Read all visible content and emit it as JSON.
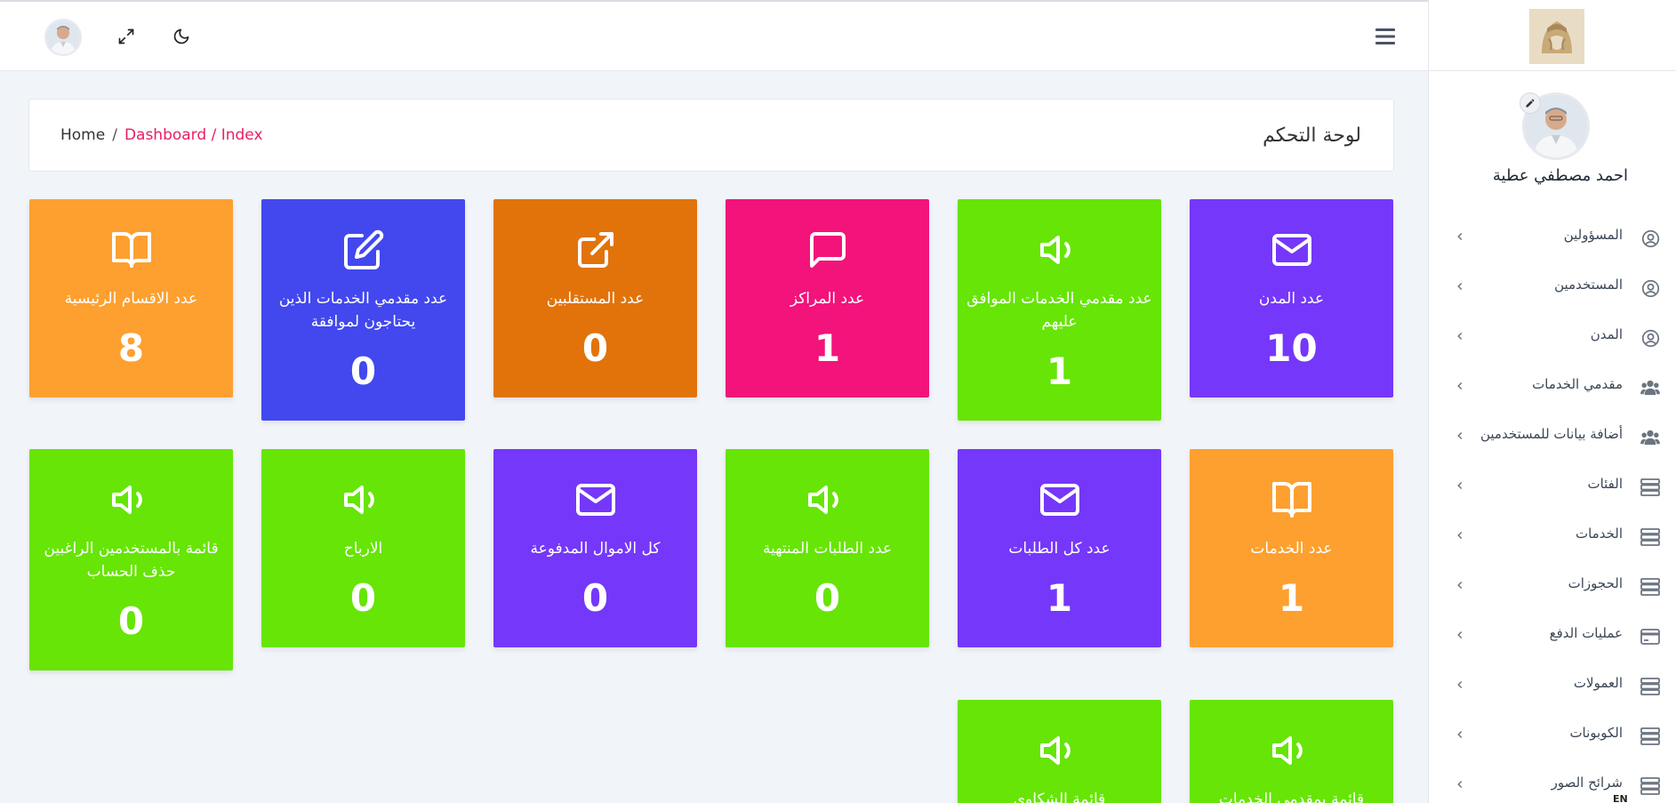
{
  "topbar": {
    "avatar_icon": "user-avatar",
    "expand_icon": "expand-icon",
    "theme_icon": "moon-icon",
    "menu_icon": "hamburger-menu-icon"
  },
  "sidebar": {
    "logo_icon": "brand-logo",
    "user_name": "احمد مصطفي عطية",
    "items": [
      {
        "label": "المسؤولين",
        "icon": "user-circle-icon"
      },
      {
        "label": "المستخدمين",
        "icon": "user-circle-icon"
      },
      {
        "label": "المدن",
        "icon": "user-circle-icon"
      },
      {
        "label": "مقدمي الخدمات",
        "icon": "users-icon"
      },
      {
        "label": "أضافة بيانات للمستخدمين",
        "icon": "users-icon"
      },
      {
        "label": "الفئات",
        "icon": "server-icon"
      },
      {
        "label": "الخدمات",
        "icon": "server-icon"
      },
      {
        "label": "الحجوزات",
        "icon": "server-icon"
      },
      {
        "label": "عمليات الدفع",
        "icon": "credit-card-icon"
      },
      {
        "label": "العمولات",
        "icon": "server-icon"
      },
      {
        "label": "الكوبونات",
        "icon": "server-icon"
      },
      {
        "label": "شرائح الصور",
        "icon": "server-icon"
      }
    ],
    "lang": "EN"
  },
  "breadcrumb": {
    "home": "Home",
    "separator": "/",
    "active": "Dashboard / Index",
    "title": "لوحة التحكم"
  },
  "tiles": [
    {
      "label": "عدد المدن",
      "value": "10",
      "icon": "envelope-icon",
      "color": "#7537fa"
    },
    {
      "label": "عدد مقدمي الخدمات الموافق عليهم",
      "value": "1",
      "icon": "megaphone-icon",
      "color": "#66e506"
    },
    {
      "label": "عدد المراكز",
      "value": "1",
      "icon": "message-square-icon",
      "color": "#f2137b"
    },
    {
      "label": "عدد المستقلبين",
      "value": "0",
      "icon": "external-link-icon",
      "color": "#e2730b"
    },
    {
      "label": "عدد مقدمي الخدمات الذين يحتاجون لموافقة",
      "value": "0",
      "icon": "edit-icon",
      "color": "#4248ee"
    },
    {
      "label": "عدد الاقسام الرئيسية",
      "value": "8",
      "icon": "book-open-icon",
      "color": "#fda02f"
    },
    {
      "label": "عدد الخدمات",
      "value": "1",
      "icon": "book-open-icon",
      "color": "#fda02f"
    },
    {
      "label": "عدد كل الطلبات",
      "value": "1",
      "icon": "envelope-icon",
      "color": "#7537fa"
    },
    {
      "label": "عدد الطلبات المنتهية",
      "value": "0",
      "icon": "megaphone-icon",
      "color": "#66e506"
    },
    {
      "label": "كل الاموال المدفوعة",
      "value": "0",
      "icon": "envelope-icon",
      "color": "#7537fa"
    },
    {
      "label": "الارباح",
      "value": "0",
      "icon": "megaphone-icon",
      "color": "#66e506"
    },
    {
      "label": "قائمة بالمستخدمين الراغبين حذف الحساب",
      "value": "0",
      "icon": "megaphone-icon",
      "color": "#66e506"
    },
    {
      "label": "قائمة بمقدمي الخدمات",
      "icon": "megaphone-icon",
      "color": "#66e506"
    },
    {
      "label": "قائمة الشكاوى",
      "icon": "megaphone-icon",
      "color": "#66e506"
    }
  ]
}
